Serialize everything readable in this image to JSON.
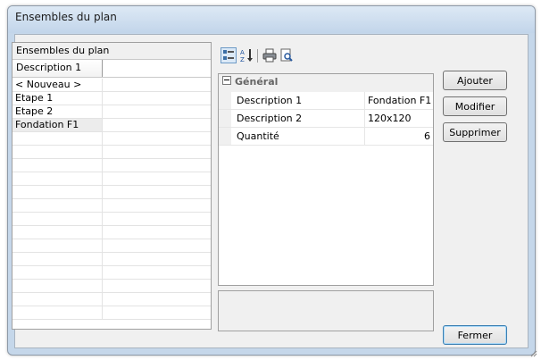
{
  "window": {
    "title": "Ensembles du plan"
  },
  "list": {
    "header": "Ensembles du plan",
    "column": "Description 1",
    "rows": [
      {
        "label": "< Nouveau >",
        "selected": false
      },
      {
        "label": "Etape 1",
        "selected": false
      },
      {
        "label": "Etape 2",
        "selected": false
      },
      {
        "label": "Fondation F1",
        "selected": true
      }
    ]
  },
  "toolbar": {
    "icons": [
      "categorized-icon",
      "sort-alphabetical-icon",
      "print-icon",
      "preview-icon"
    ]
  },
  "propgrid": {
    "category": "Général",
    "rows": [
      {
        "name": "Description 1",
        "value": "Fondation F1"
      },
      {
        "name": "Description 2",
        "value": "120x120"
      },
      {
        "name": "Quantité",
        "value": "6"
      }
    ]
  },
  "buttons": {
    "ajouter": "Ajouter",
    "modifier": "Modifier",
    "supprimer": "Supprimer",
    "fermer": "Fermer"
  },
  "colors": {
    "frame": "#c5d7ea",
    "client": "#f0f0f0",
    "selection": "#ececec",
    "toolbar_active": "#dbe9f7"
  }
}
